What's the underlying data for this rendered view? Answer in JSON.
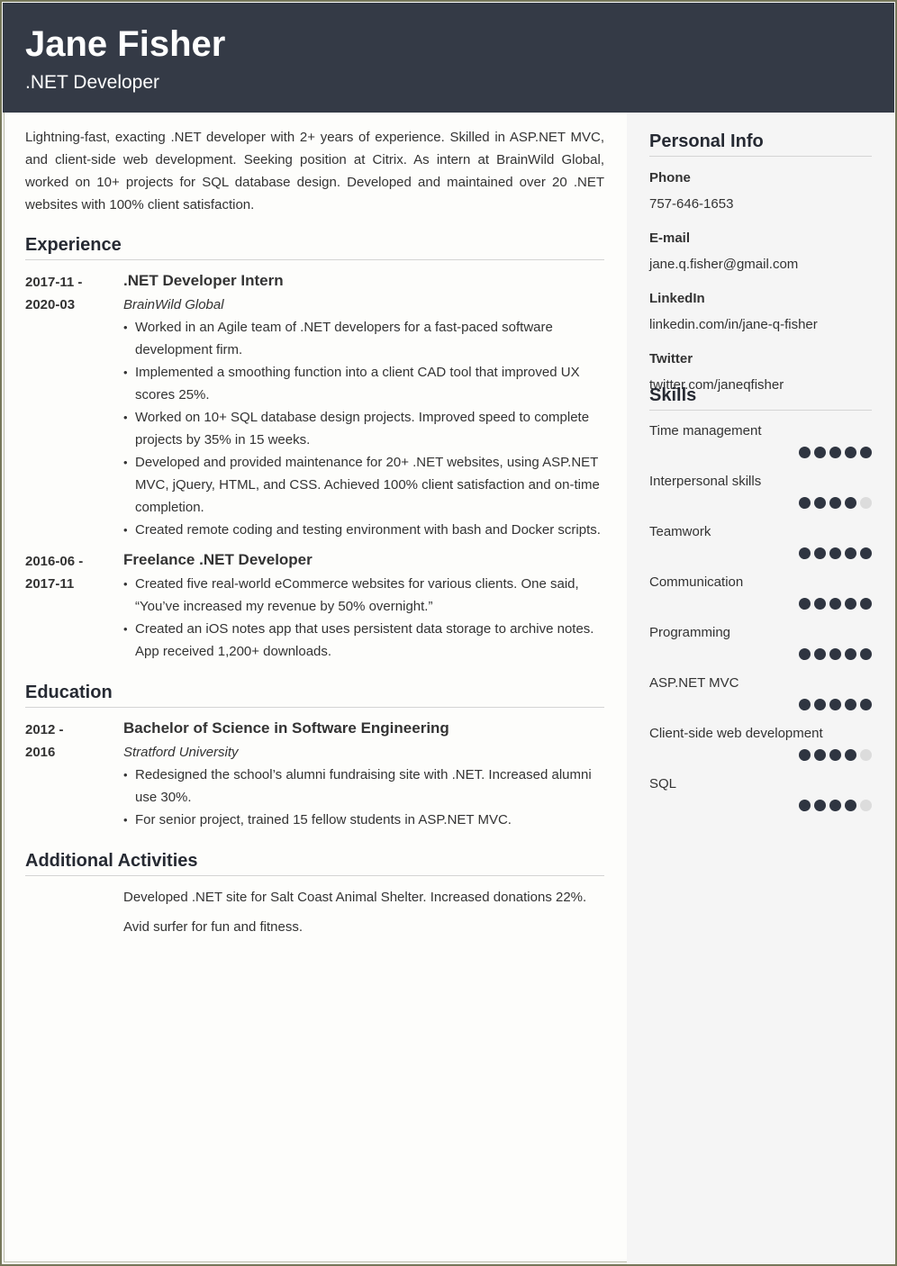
{
  "header": {
    "name": "Jane Fisher",
    "title": ".NET Developer"
  },
  "summary": "Lightning-fast, exacting .NET developer with 2+ years of experience. Skilled in ASP.NET MVC, and client-side web development. Seeking position at Citrix. As intern at BrainWild Global, worked on 10+ projects for SQL database design. Developed and maintained over 20 .NET websites with 100% client satisfaction.",
  "experience": {
    "heading": "Experience",
    "entries": [
      {
        "date_start": "2017-11 -",
        "date_end": "2020-03",
        "role": ".NET Developer Intern",
        "org": "BrainWild Global",
        "bullets": [
          "Worked in an Agile team of .NET developers for a fast-paced software development firm.",
          "Implemented a smoothing function into a client CAD tool that improved UX scores 25%.",
          "Worked on 10+ SQL database design projects. Improved speed to complete projects by 35% in 15 weeks.",
          "Developed and provided maintenance for 20+ .NET websites, using ASP.NET MVC, jQuery, HTML, and CSS. Achieved 100% client satisfaction and on-time completion.",
          "Created remote coding and testing environment with bash and Docker scripts."
        ]
      },
      {
        "date_start": "2016-06 -",
        "date_end": "2017-11",
        "role": "Freelance .NET Developer",
        "org": "",
        "bullets": [
          "Created five real-world eCommerce websites for various clients. One said, “You’ve increased my revenue by 50% overnight.”",
          "Created an iOS notes app that uses persistent data storage to archive notes. App received 1,200+ downloads."
        ]
      }
    ]
  },
  "education": {
    "heading": "Education",
    "entries": [
      {
        "date_start": "2012 -",
        "date_end": "2016",
        "degree": "Bachelor of Science in Software Engineering",
        "school": "Stratford University",
        "bullets": [
          "Redesigned the school’s alumni fundraising site with .NET. Increased alumni use 30%.",
          "For senior project, trained 15 fellow students in ASP.NET MVC."
        ]
      }
    ]
  },
  "activities": {
    "heading": "Additional Activities",
    "items": [
      "Developed .NET site for Salt Coast Animal Shelter. Increased donations 22%.",
      "Avid surfer for fun and fitness."
    ]
  },
  "personal_info": {
    "heading": "Personal Info",
    "fields": [
      {
        "label": "Phone",
        "value": "757-646-1653"
      },
      {
        "label": "E-mail",
        "value": "jane.q.fisher@gmail.com"
      },
      {
        "label": "LinkedIn",
        "value": "linkedin.com/in/jane-q-fisher"
      },
      {
        "label": "Twitter",
        "value": "twitter.com/janeqfisher"
      }
    ]
  },
  "skills": {
    "heading": "Skills",
    "max_rating": 5,
    "items": [
      {
        "name": "Time management",
        "rating": 5
      },
      {
        "name": "Interpersonal skills",
        "rating": 4
      },
      {
        "name": "Teamwork",
        "rating": 5
      },
      {
        "name": "Communication",
        "rating": 5
      },
      {
        "name": "Programming",
        "rating": 5
      },
      {
        "name": "ASP.NET MVC",
        "rating": 5
      },
      {
        "name": "Client-side web development",
        "rating": 4
      },
      {
        "name": "SQL",
        "rating": 4
      }
    ]
  },
  "colors": {
    "header_bg": "#343a46",
    "sidebar_bg": "#f5f5f5",
    "rating_on": "#2f3541",
    "rating_off": "#dcdcdc"
  }
}
